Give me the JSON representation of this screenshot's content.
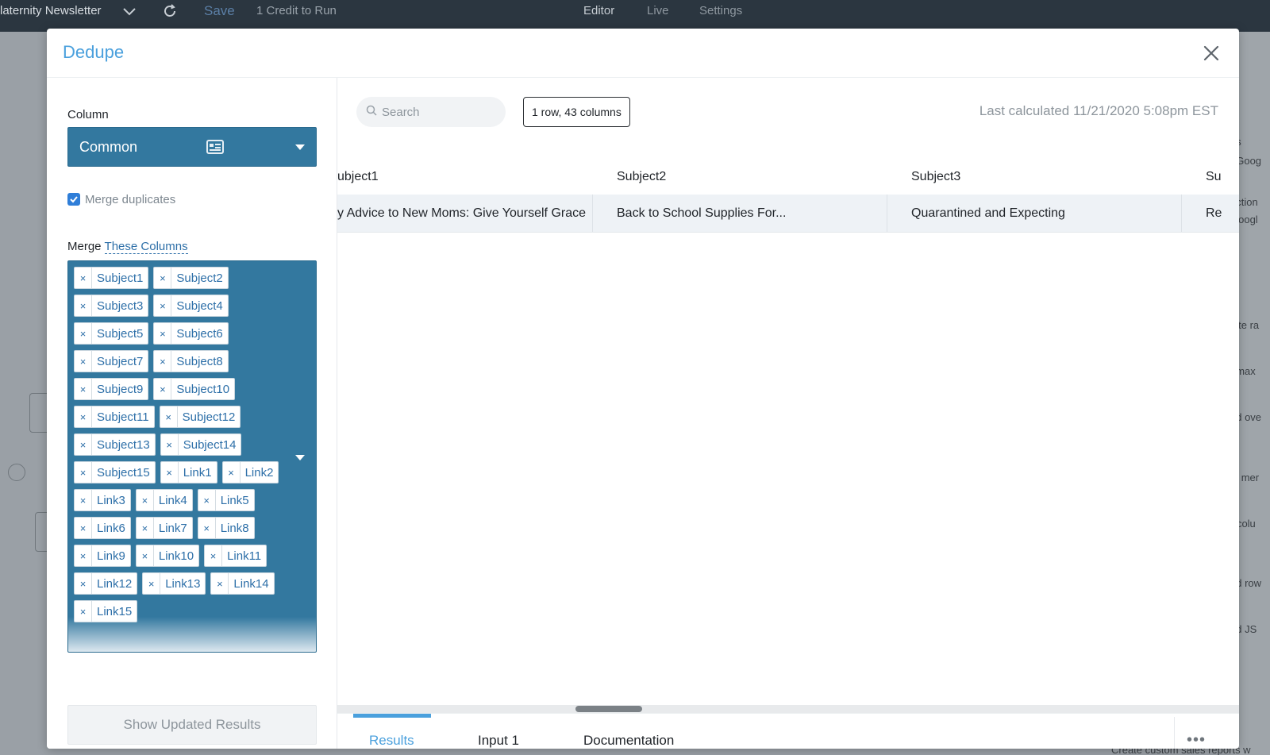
{
  "topbar": {
    "title": "laternity Newsletter",
    "save_label": "Save",
    "credit_label": "1 Credit to Run",
    "tabs": [
      "Editor",
      "Live",
      "Settings"
    ]
  },
  "background": {
    "right_snippets": [
      "ps",
      ", Goog",
      "action",
      "Googl",
      "late ra",
      ", max",
      "nd ove",
      "s, mer",
      "r colu",
      "nd row",
      "nd JS"
    ],
    "bottom_snippet": "Create custom sales reports w"
  },
  "modal": {
    "title": "Dedupe",
    "close_icon": "close-icon"
  },
  "left": {
    "column_label": "Column",
    "column_value": "Common",
    "merge_duplicates_label": "Merge duplicates",
    "merge_duplicates_checked": true,
    "merge_label": "Merge",
    "merge_link": "These Columns",
    "tags": [
      "Subject1",
      "Subject2",
      "Subject3",
      "Subject4",
      "Subject5",
      "Subject6",
      "Subject7",
      "Subject8",
      "Subject9",
      "Subject10",
      "Subject11",
      "Subject12",
      "Subject13",
      "Subject14",
      "Subject15",
      "Link1",
      "Link2",
      "Link3",
      "Link4",
      "Link5",
      "Link6",
      "Link7",
      "Link8",
      "Link9",
      "Link10",
      "Link11",
      "Link12",
      "Link13",
      "Link14",
      "Link15"
    ],
    "show_results_label": "Show Updated Results"
  },
  "right": {
    "search_placeholder": "Search",
    "row_badge": "1 row, 43 columns",
    "last_calculated": "Last calculated 11/21/2020 5:08pm EST",
    "table": {
      "headers": [
        "ubject1",
        "Subject2",
        "Subject3",
        "Su"
      ],
      "row": [
        "y Advice to New Moms: Give Yourself Grace",
        "Back to School Supplies For...",
        "Quarantined and Expecting",
        "Re"
      ]
    },
    "tabs": [
      "Results",
      "Input 1",
      "Documentation"
    ],
    "active_tab": "Results",
    "more_label": "•••"
  },
  "colors": {
    "accent": "#4aa0dd",
    "select_bg": "#33789f",
    "topbar_bg": "#2b3640"
  }
}
